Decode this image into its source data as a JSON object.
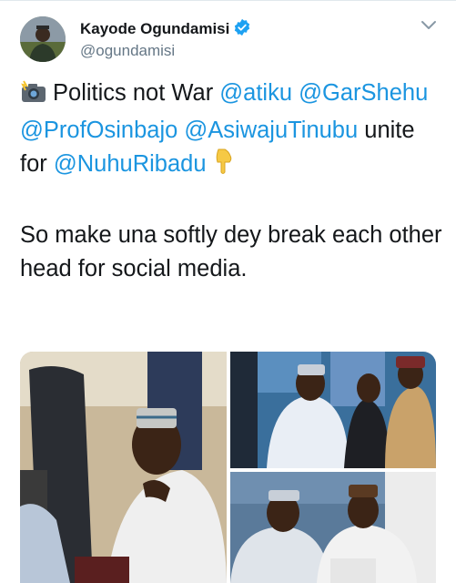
{
  "tweet": {
    "author_name": "Kayode Ogundamisi",
    "author_handle": "@ogundamisi",
    "verified": true,
    "text_line1_prefix": "Politics not War",
    "mentions": [
      "@atiku",
      "@GarShehu",
      "@ProfOsinbajo",
      "@AsiwajuTinubu",
      "@NuhuRibadu"
    ],
    "text_unite": "unite for",
    "text_para2": "So make una softly dey break each other head for social media."
  },
  "icons": {
    "avatar": "avatar",
    "verified": "verified-badge-icon",
    "menu": "chevron-down-icon",
    "camera": "camera-flash-emoji-icon",
    "pointing": "pointing-down-emoji-icon"
  },
  "colors": {
    "link": "#1b95e0",
    "text": "#14171a",
    "secondary": "#657786",
    "verified": "#1da1f2"
  },
  "media": {
    "count": 3,
    "items": [
      "photo-1",
      "photo-2",
      "photo-3"
    ]
  }
}
